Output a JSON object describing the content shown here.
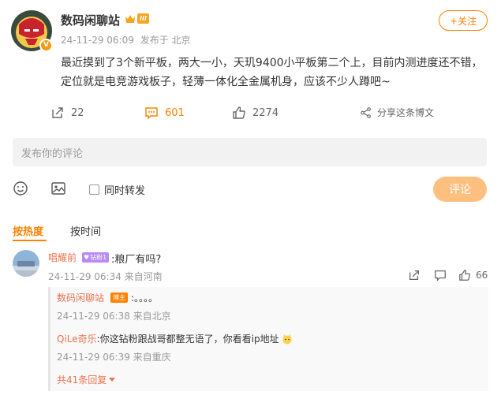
{
  "post": {
    "author_name": "数码闲聊站",
    "vip_level": "III",
    "time": "24-11-29 06:09",
    "source": "发布于 北京",
    "follow_label": "+关注",
    "text": "最近摸到了3个新平板，两大一小，天玑9400小平板第二个上，目前内测进度还不错，定位就是电竞游戏板子，轻薄一体化全金属机身，应该不少人蹲吧~"
  },
  "actions": {
    "share_count": "22",
    "comment_count": "601",
    "like_count": "2274",
    "forward_label": "分享这条博文"
  },
  "composer": {
    "placeholder": "发布你的评论",
    "repost_label": "同时转发",
    "submit_label": "评论"
  },
  "sort": {
    "hot_label": "按热度",
    "time_label": "按时间"
  },
  "comment": {
    "author": "唱耀前",
    "fan_badge": "钻粉1",
    "text": ":粮厂有吗?",
    "time": "24-11-29 06:34 来自河南",
    "like_count": "66"
  },
  "replies": [
    {
      "author": "数码闲聊站",
      "tag": "博主",
      "text": ":。。。。",
      "meta": "24-11-29 06:38 来自北京"
    },
    {
      "author": "QiLe奇乐",
      "text": ":你这钻粉跟战哥都整无语了，你看看ip地址",
      "meta": "24-11-29 06:39 来自重庆"
    }
  ],
  "more_replies_label": "共41条回复",
  "colors": {
    "accent": "#ff8200",
    "name": "#eb7350",
    "muted": "#999999"
  }
}
